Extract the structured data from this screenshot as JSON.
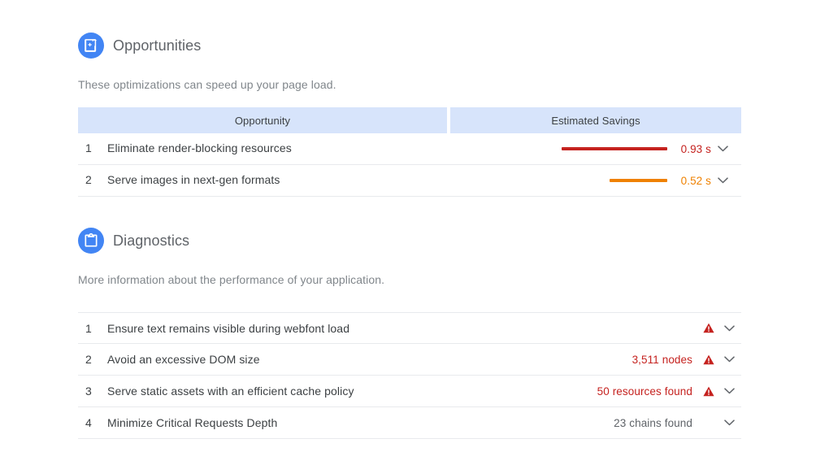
{
  "opportunities": {
    "icon": "image-opportunity-icon",
    "title": "Opportunities",
    "description": "These optimizations can speed up your page load.",
    "columns": {
      "opportunity": "Opportunity",
      "savings": "Estimated Savings"
    },
    "rows": [
      {
        "index": "1",
        "label": "Eliminate render-blocking resources",
        "value": "0.93 s",
        "bar_color": "#c5221f",
        "bar_ratio": 1.0,
        "expand_icon": "chevron-down-icon"
      },
      {
        "index": "2",
        "label": "Serve images in next-gen formats",
        "value": "0.52 s",
        "bar_color": "#ef8100",
        "bar_ratio": 0.545,
        "expand_icon": "chevron-down-icon"
      }
    ]
  },
  "diagnostics": {
    "icon": "clipboard-icon",
    "title": "Diagnostics",
    "description": "More information about the performance of your application.",
    "rows": [
      {
        "index": "1",
        "label": "Ensure text remains visible during webfont load",
        "value": "",
        "warning": true,
        "warning_icon": "warning-triangle-icon",
        "expand_icon": "chevron-down-icon"
      },
      {
        "index": "2",
        "label": "Avoid an excessive DOM size",
        "value": "3,511 nodes",
        "warning": true,
        "warning_icon": "warning-triangle-icon",
        "expand_icon": "chevron-down-icon"
      },
      {
        "index": "3",
        "label": "Serve static assets with an efficient cache policy",
        "value": "50 resources found",
        "warning": true,
        "warning_icon": "warning-triangle-icon",
        "expand_icon": "chevron-down-icon"
      },
      {
        "index": "4",
        "label": "Minimize Critical Requests Depth",
        "value": "23 chains found",
        "warning": false,
        "warning_icon": "",
        "expand_icon": "chevron-down-icon"
      }
    ]
  },
  "colors": {
    "accent_blue": "#4285f4",
    "header_bg": "#d7e4fb",
    "warning_red": "#c5221f",
    "average_orange": "#ef8100",
    "text_primary": "#3c4043",
    "text_secondary": "#80868b",
    "divider": "#e8eaed"
  }
}
